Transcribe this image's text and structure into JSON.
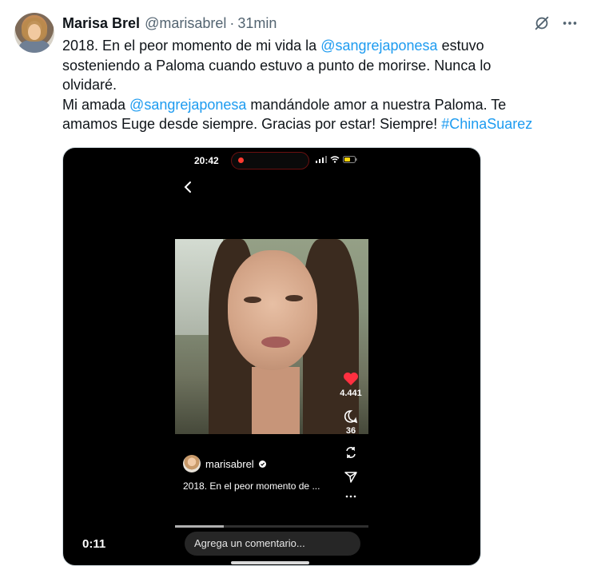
{
  "tweet": {
    "author_name": "Marisa Brel",
    "handle": "@marisabrel",
    "separator": "·",
    "time": "31min",
    "text": {
      "l1_a": "2018. En el peor momento de mi vida la ",
      "l1_mention": "@sangrejaponesa",
      "l1_b": " estuvo",
      "l2": "sosteniendo a Paloma cuando estuvo a punto de morirse. Nunca lo",
      "l3": "olvidaré.",
      "l4_a": "Mi amada ",
      "l4_mention": "@sangrejaponesa",
      "l4_b": " mandándole amor a nuestra Paloma. Te",
      "l5_a": "amamos Euge desde siempre. Gracias por  estar! Siempre! ",
      "l5_hashtag": "#ChinaSuarez"
    },
    "icons": {
      "grok": "grok-icon",
      "more": "more-icon"
    }
  },
  "media": {
    "duration": "0:11",
    "playback_progress": 0.25,
    "phone": {
      "status_time": "20:42",
      "likes": "4.441",
      "comments": "36",
      "username": "marisabrel",
      "caption": "2018. En el peor momento de ...",
      "comment_placeholder": "Agrega un comentario..."
    }
  },
  "colors": {
    "link": "#1d9bf0",
    "text": "#0f1419",
    "muted": "#536471",
    "like": "#ff3040"
  }
}
